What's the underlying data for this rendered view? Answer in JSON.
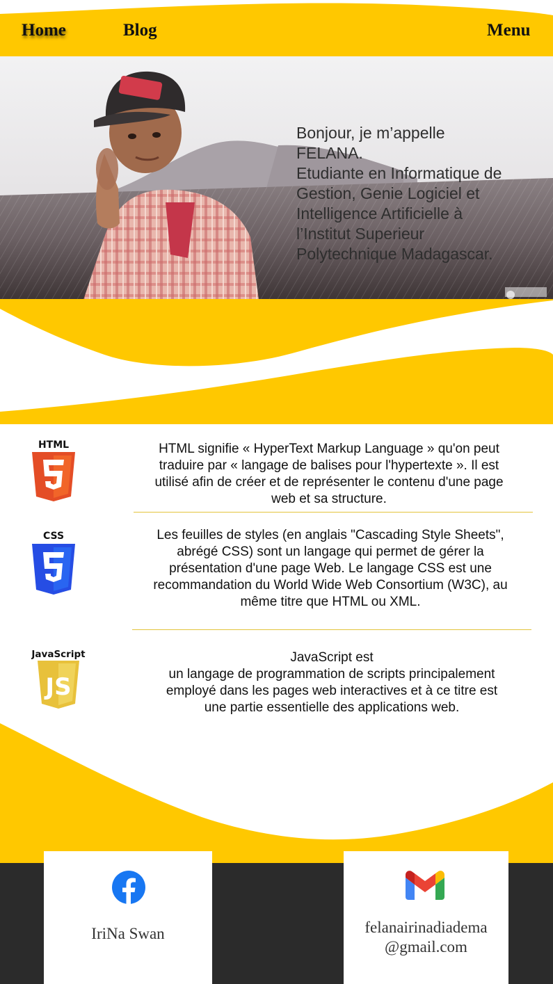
{
  "colors": {
    "accent": "#FFC800",
    "footer": "#2b2b2b",
    "white": "#ffffff",
    "html5": "#E44D26",
    "css3": "#264DE4",
    "js": "#E8C13B"
  },
  "nav": {
    "home": "Home",
    "blog": "Blog",
    "menu": "Menu"
  },
  "hero": {
    "image": "photo of a person wearing a cap and plaid shirt pointing at the camera",
    "intro_lines": [
      "Bonjour, je m’appelle",
      "FELANA.",
      "Etudiante en Informatique de",
      "Gestion, Genie Logiciel et",
      "Intelligence Artificielle à",
      "l’Institut Superieur",
      "Polytechnique Madagascar."
    ]
  },
  "tech": {
    "html": {
      "icon": "html5-icon",
      "icon_label": "HTML",
      "lines": [
        "HTML signifie « HyperText Markup Language » qu'on peut",
        "traduire par « langage de balises pour l'hypertexte ». Il est",
        "utilisé afin de créer et de représenter le contenu d'une page",
        "web et sa structure."
      ]
    },
    "css": {
      "icon": "css3-icon",
      "icon_label": "CSS",
      "lines": [
        "Les feuilles de styles (en anglais \"Cascading Style Sheets\",",
        "abrégé CSS) sont un langage qui permet de gérer la",
        "présentation d'une page Web. Le langage CSS est une",
        "recommandation du World Wide Web Consortium (W3C), au",
        "même titre que HTML ou XML."
      ]
    },
    "js": {
      "icon": "javascript-icon",
      "icon_label": "JavaScript",
      "icon_mark": "JS",
      "lines": [
        "JavaScript est",
        " un langage de programmation de scripts principalement",
        "employé dans les pages web interactives et à ce titre est",
        "une partie essentielle des applications web."
      ]
    }
  },
  "contact": {
    "facebook": {
      "icon": "facebook-icon",
      "name": "IriNa Swan"
    },
    "gmail": {
      "icon": "gmail-icon",
      "email_lines": [
        "felanairinadiadema",
        "@gmail.com"
      ]
    }
  }
}
